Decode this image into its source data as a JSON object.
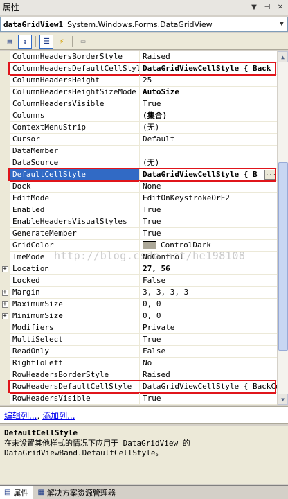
{
  "window": {
    "title": "属性"
  },
  "object_selector": {
    "name": "dataGridView1",
    "type": "System.Windows.Forms.DataGridView"
  },
  "toolbar": {
    "buttons": [
      "categorized",
      "alphabetical",
      "properties",
      "events",
      "property-pages"
    ]
  },
  "properties": [
    {
      "name": "ColumnHeadersBorderStyle",
      "value": "Raised"
    },
    {
      "name": "ColumnHeadersDefaultCellStyle",
      "value": "DataGridViewCellStyle { Back",
      "bold": true,
      "highlight": true
    },
    {
      "name": "ColumnHeadersHeight",
      "value": "25"
    },
    {
      "name": "ColumnHeadersHeightSizeMode",
      "value": "AutoSize",
      "bold": true
    },
    {
      "name": "ColumnHeadersVisible",
      "value": "True"
    },
    {
      "name": "Columns",
      "value": "(集合)",
      "bold": true
    },
    {
      "name": "ContextMenuStrip",
      "value": "(无)"
    },
    {
      "name": "Cursor",
      "value": "Default"
    },
    {
      "name": "DataMember",
      "value": ""
    },
    {
      "name": "DataSource",
      "value": "(无)"
    },
    {
      "name": "DefaultCellStyle",
      "value": "DataGridViewCellStyle { B",
      "bold": true,
      "selected": true,
      "highlight": true
    },
    {
      "name": "Dock",
      "value": "None"
    },
    {
      "name": "EditMode",
      "value": "EditOnKeystrokeOrF2"
    },
    {
      "name": "Enabled",
      "value": "True"
    },
    {
      "name": "EnableHeadersVisualStyles",
      "value": "True"
    },
    {
      "name": "GenerateMember",
      "value": "True"
    },
    {
      "name": "GridColor",
      "value": "ControlDark",
      "swatch": "#aca899"
    },
    {
      "name": "ImeMode",
      "value": "NoControl"
    },
    {
      "name": "Location",
      "value": "27, 56",
      "bold": true,
      "expandable": true
    },
    {
      "name": "Locked",
      "value": "False"
    },
    {
      "name": "Margin",
      "value": "3, 3, 3, 3",
      "expandable": true
    },
    {
      "name": "MaximumSize",
      "value": "0, 0",
      "expandable": true
    },
    {
      "name": "MinimumSize",
      "value": "0, 0",
      "expandable": true
    },
    {
      "name": "Modifiers",
      "value": "Private"
    },
    {
      "name": "MultiSelect",
      "value": "True"
    },
    {
      "name": "ReadOnly",
      "value": "False"
    },
    {
      "name": "RightToLeft",
      "value": "No"
    },
    {
      "name": "RowHeadersBorderStyle",
      "value": "Raised"
    },
    {
      "name": "RowHeadersDefaultCellStyle",
      "value": "DataGridViewCellStyle { BackColo",
      "highlight": true
    },
    {
      "name": "RowHeadersVisible",
      "value": "True"
    }
  ],
  "watermark": "http://blog.csdn.net/he198108",
  "commands": {
    "edit_columns": "编辑列...",
    "add_column": "添加列..."
  },
  "description": {
    "title": "DefaultCellStyle",
    "text": "在未设置其他样式的情况下应用于 DataGridView 的 DataGridViewBand.DefaultCellStyle。"
  },
  "tabs": [
    {
      "label": "属性",
      "active": true
    },
    {
      "label": "解决方案资源管理器",
      "active": false
    }
  ]
}
